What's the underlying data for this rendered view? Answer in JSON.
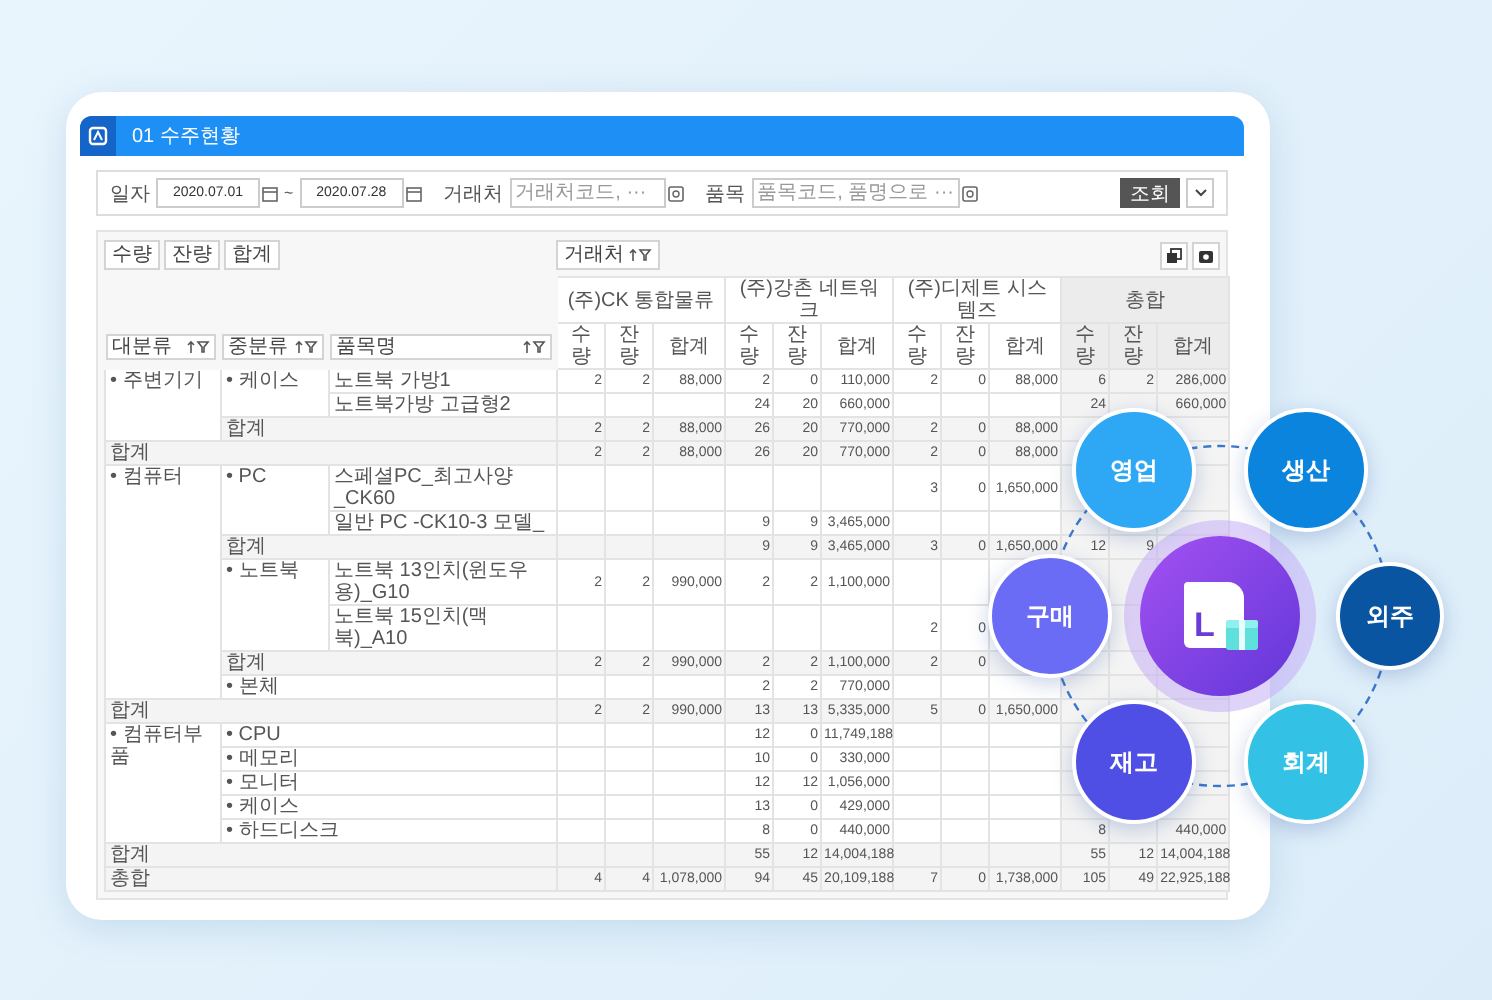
{
  "window": {
    "title": "01 수주현황"
  },
  "filters": {
    "date_label": "일자",
    "date_from": "2020.07.01",
    "range_separator": "~",
    "date_to": "2020.07.28",
    "customer_label": "거래처",
    "customer_placeholder": "거래처코드, ···",
    "item_label": "품목",
    "item_placeholder": "품목코드, 품명으로 ···"
  },
  "search_button": "조회",
  "toolbar": {
    "measure_buttons": [
      "수량",
      "잔량",
      "합계"
    ],
    "pivot_field": "거래처"
  },
  "table": {
    "row_fields": [
      "대분류",
      "중분류",
      "품목명"
    ],
    "column_groups": [
      {
        "name": "(주)CK 통합물류",
        "measures": [
          "수량",
          "잔량",
          "합계"
        ]
      },
      {
        "name": "(주)강촌 네트워크",
        "measures": [
          "수량",
          "잔량",
          "합계"
        ]
      },
      {
        "name": "(주)디제트 시스템즈",
        "measures": [
          "수량",
          "잔량",
          "합계"
        ]
      },
      {
        "name": "총합",
        "measures": [
          "수량",
          "잔량",
          "합계"
        ]
      }
    ],
    "groups": [
      {
        "name": "• 주변기기",
        "subgroups": [
          {
            "name": "• 케이스",
            "items": [
              {
                "name": "노트북 가방1",
                "values": {
                  "ck_qty": "2",
                  "ck_rem": "2",
                  "ck_amt": "88,000",
                  "gc_qty": "2",
                  "gc_rem": "0",
                  "gc_amt": "110,000",
                  "dj_qty": "2",
                  "dj_rem": "0",
                  "dj_amt": "88,000",
                  "tot_qty": "6",
                  "tot_rem": "2",
                  "tot_amt": "286,000"
                }
              },
              {
                "name": "노트북가방 고급형2",
                "values": {
                  "gc_qty": "24",
                  "gc_rem": "20",
                  "gc_amt": "660,000",
                  "tot_qty": "24",
                  "tot_amt": "660,000"
                }
              }
            ],
            "subtotal": {
              "label": "합계",
              "values": {
                "ck_qty": "2",
                "ck_rem": "2",
                "ck_amt": "88,000",
                "gc_qty": "26",
                "gc_rem": "20",
                "gc_amt": "770,000",
                "dj_qty": "2",
                "dj_rem": "0",
                "dj_amt": "88,000"
              }
            }
          }
        ],
        "total": {
          "label": "합계",
          "values": {
            "ck_qty": "2",
            "ck_rem": "2",
            "ck_amt": "88,000",
            "gc_qty": "26",
            "gc_rem": "20",
            "gc_amt": "770,000",
            "dj_qty": "2",
            "dj_rem": "0",
            "dj_amt": "88,000"
          }
        }
      },
      {
        "name": "• 컴퓨터",
        "subgroups": [
          {
            "name": "• PC",
            "items": [
              {
                "name": "스페셜PC_최고사양_CK60",
                "values": {
                  "dj_qty": "3",
                  "dj_rem": "0",
                  "dj_amt": "1,650,000"
                }
              },
              {
                "name": "일반 PC -CK10-3 모델_",
                "values": {
                  "gc_qty": "9",
                  "gc_rem": "9",
                  "gc_amt": "3,465,000"
                }
              }
            ],
            "subtotal": {
              "label": "합계",
              "values": {
                "gc_qty": "9",
                "gc_rem": "9",
                "gc_amt": "3,465,000",
                "dj_qty": "3",
                "dj_rem": "0",
                "dj_amt": "1,650,000",
                "tot_qty": "12",
                "tot_rem": "9"
              }
            }
          },
          {
            "name": "• 노트북",
            "items": [
              {
                "name": "노트북 13인치(윈도우 용)_G10",
                "values": {
                  "ck_qty": "2",
                  "ck_rem": "2",
                  "ck_amt": "990,000",
                  "gc_qty": "2",
                  "gc_rem": "2",
                  "gc_amt": "1,100,000"
                }
              },
              {
                "name": "노트북 15인치(맥북)_A10",
                "values": {
                  "dj_qty": "2",
                  "dj_rem": "0"
                }
              }
            ],
            "subtotal": {
              "label": "합계",
              "values": {
                "ck_qty": "2",
                "ck_rem": "2",
                "ck_amt": "990,000",
                "gc_qty": "2",
                "gc_rem": "2",
                "gc_amt": "1,100,000",
                "dj_qty": "2",
                "dj_rem": "0"
              }
            }
          },
          {
            "name": "• 본체",
            "values": {
              "gc_qty": "2",
              "gc_rem": "2",
              "gc_amt": "770,000"
            }
          }
        ],
        "total": {
          "label": "합계",
          "values": {
            "ck_qty": "2",
            "ck_rem": "2",
            "ck_amt": "990,000",
            "gc_qty": "13",
            "gc_rem": "13",
            "gc_amt": "5,335,000",
            "dj_qty": "5",
            "dj_rem": "0",
            "dj_amt": "1,650,000"
          }
        }
      },
      {
        "name": "• 컴퓨터부품",
        "subgroups": [
          {
            "name": "• CPU",
            "values": {
              "gc_qty": "12",
              "gc_rem": "0",
              "gc_amt": "11,749,188"
            }
          },
          {
            "name": "• 메모리",
            "values": {
              "gc_qty": "10",
              "gc_rem": "0",
              "gc_amt": "330,000"
            }
          },
          {
            "name": "• 모니터",
            "values": {
              "gc_qty": "12",
              "gc_rem": "12",
              "gc_amt": "1,056,000"
            }
          },
          {
            "name": "• 케이스",
            "values": {
              "gc_qty": "13",
              "gc_rem": "0",
              "gc_amt": "429,000"
            }
          },
          {
            "name": "• 하드디스크",
            "values": {
              "gc_qty": "8",
              "gc_rem": "0",
              "gc_amt": "440,000",
              "tot_qty": "8",
              "tot_amt": "440,000"
            }
          }
        ],
        "total": {
          "label": "합계",
          "values": {
            "gc_qty": "55",
            "gc_rem": "12",
            "gc_amt": "14,004,188",
            "tot_qty": "55",
            "tot_rem": "12",
            "tot_amt": "14,004,188"
          }
        }
      }
    ],
    "grand_total": {
      "label": "총합",
      "values": {
        "ck_qty": "4",
        "ck_rem": "4",
        "ck_amt": "1,078,000",
        "gc_qty": "94",
        "gc_rem": "45",
        "gc_amt": "20,109,188",
        "dj_qty": "7",
        "dj_rem": "0",
        "dj_amt": "1,738,000",
        "tot_qty": "105",
        "tot_rem": "49",
        "tot_amt": "22,925,188"
      }
    }
  },
  "modules": [
    {
      "label": "영업",
      "color": "#2ea8f5"
    },
    {
      "label": "생산",
      "color": "#0b84de"
    },
    {
      "label": "외주",
      "color": "#0a55a2"
    },
    {
      "label": "회계",
      "color": "#33c2e6"
    },
    {
      "label": "재고",
      "color": "#4f4fe6"
    },
    {
      "label": "구매",
      "color": "#6a6cf6"
    }
  ],
  "logo_letter": "L"
}
